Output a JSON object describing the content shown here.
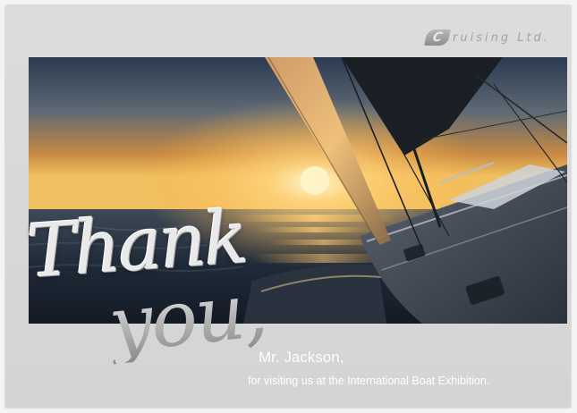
{
  "brand": {
    "logo_letter": "C",
    "logo_text": "ruising Ltd."
  },
  "greeting": {
    "line1": "Thank",
    "line2": "you,"
  },
  "recipient": {
    "name": "Mr. Jackson,",
    "message": "for visiting us at the International Boat Exhibition."
  },
  "colors": {
    "card_background": "#d8d8d8",
    "text_white": "#ffffff",
    "sunset_orange": "#e98a2c"
  }
}
